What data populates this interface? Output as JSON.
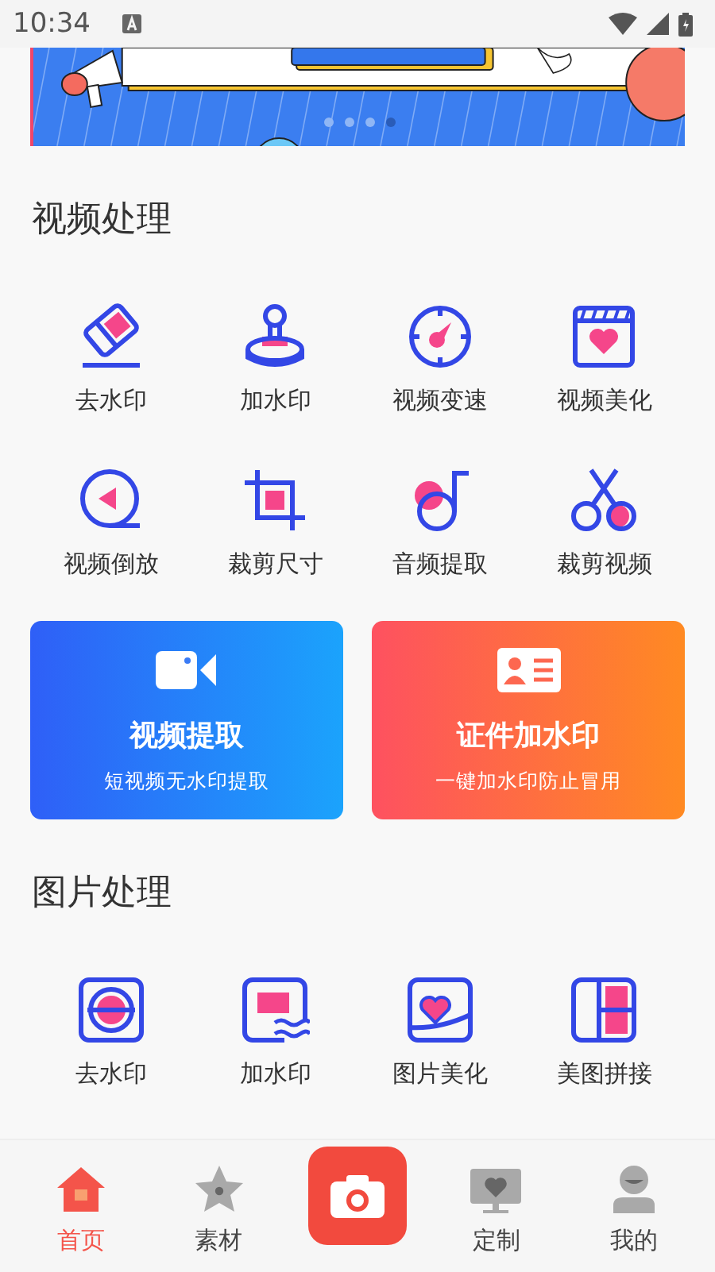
{
  "status_bar": {
    "time": "10:34"
  },
  "banner": {
    "kind": "picture",
    "dots": [
      {
        "selected": false
      },
      {
        "selected": false
      },
      {
        "selected": false
      },
      {
        "selected": true
      }
    ]
  },
  "video_section": {
    "title": "视频处理",
    "tools": [
      {
        "label": "去水印"
      },
      {
        "label": "加水印"
      },
      {
        "label": "视频变速"
      },
      {
        "label": "视频美化"
      },
      {
        "label": "视频倒放"
      },
      {
        "label": "裁剪尺寸"
      },
      {
        "label": "音频提取"
      },
      {
        "label": "裁剪视频"
      }
    ]
  },
  "feature_cards": [
    {
      "title": "视频提取",
      "subtitle": "短视频无水印提取"
    },
    {
      "title": "证件加水印",
      "subtitle": "一键加水印防止冒用"
    }
  ],
  "image_section": {
    "title": "图片处理",
    "tools": [
      {
        "label": "去水印"
      },
      {
        "label": "加水印"
      },
      {
        "label": "图片美化"
      },
      {
        "label": "美图拼接"
      }
    ]
  },
  "tab_bar": [
    {
      "label": "首页",
      "selected": true
    },
    {
      "label": "素材",
      "selected": false
    },
    {
      "label": "定制",
      "selected": false
    },
    {
      "label": "我的",
      "selected": false
    }
  ]
}
